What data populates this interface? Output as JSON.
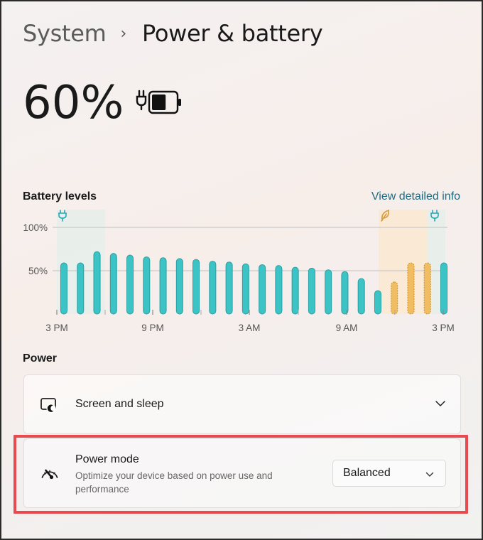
{
  "breadcrumb": {
    "parent": "System",
    "separator": "›",
    "current": "Power & battery"
  },
  "battery": {
    "percent_text": "60%",
    "level": 0.6,
    "charging": true
  },
  "battery_levels": {
    "title": "Battery levels",
    "link": "View detailed info"
  },
  "chart_data": {
    "type": "bar",
    "x_ticks": [
      "3 PM",
      "9 PM",
      "3 AM",
      "9 AM",
      "3 PM"
    ],
    "y_ticks": [
      "100%",
      "50%"
    ],
    "ylim": [
      0,
      100
    ],
    "series": [
      {
        "values": [
          59,
          59,
          72,
          70,
          68,
          66,
          65,
          64,
          63,
          61,
          60,
          58,
          57,
          56,
          54,
          53,
          51,
          49,
          41,
          27
        ],
        "color": "#3cc3c5"
      },
      {
        "values": [
          37,
          59,
          59
        ],
        "color": "#f0bd62"
      },
      {
        "values": [
          59
        ],
        "color": "#3cc3c5"
      }
    ],
    "markers": [
      {
        "icon": "plug-icon",
        "color": "#2aa6b5"
      },
      {
        "icon": "leaf-icon",
        "color": "#d99a3a"
      },
      {
        "icon": "plug-icon",
        "color": "#2aa6b5"
      }
    ]
  },
  "power": {
    "title": "Power",
    "screen_sleep": {
      "label": "Screen and sleep",
      "icon": "screen-sleep-icon"
    },
    "power_mode": {
      "label": "Power mode",
      "description": "Optimize your device based on power use and performance",
      "selected": "Balanced",
      "icon": "power-mode-gauge-icon"
    }
  },
  "colors": {
    "accent_link": "#1e6b80",
    "bar_teal": "#3cc3c5",
    "bar_saver": "#f0bd62",
    "highlight": "#e84a4f"
  }
}
